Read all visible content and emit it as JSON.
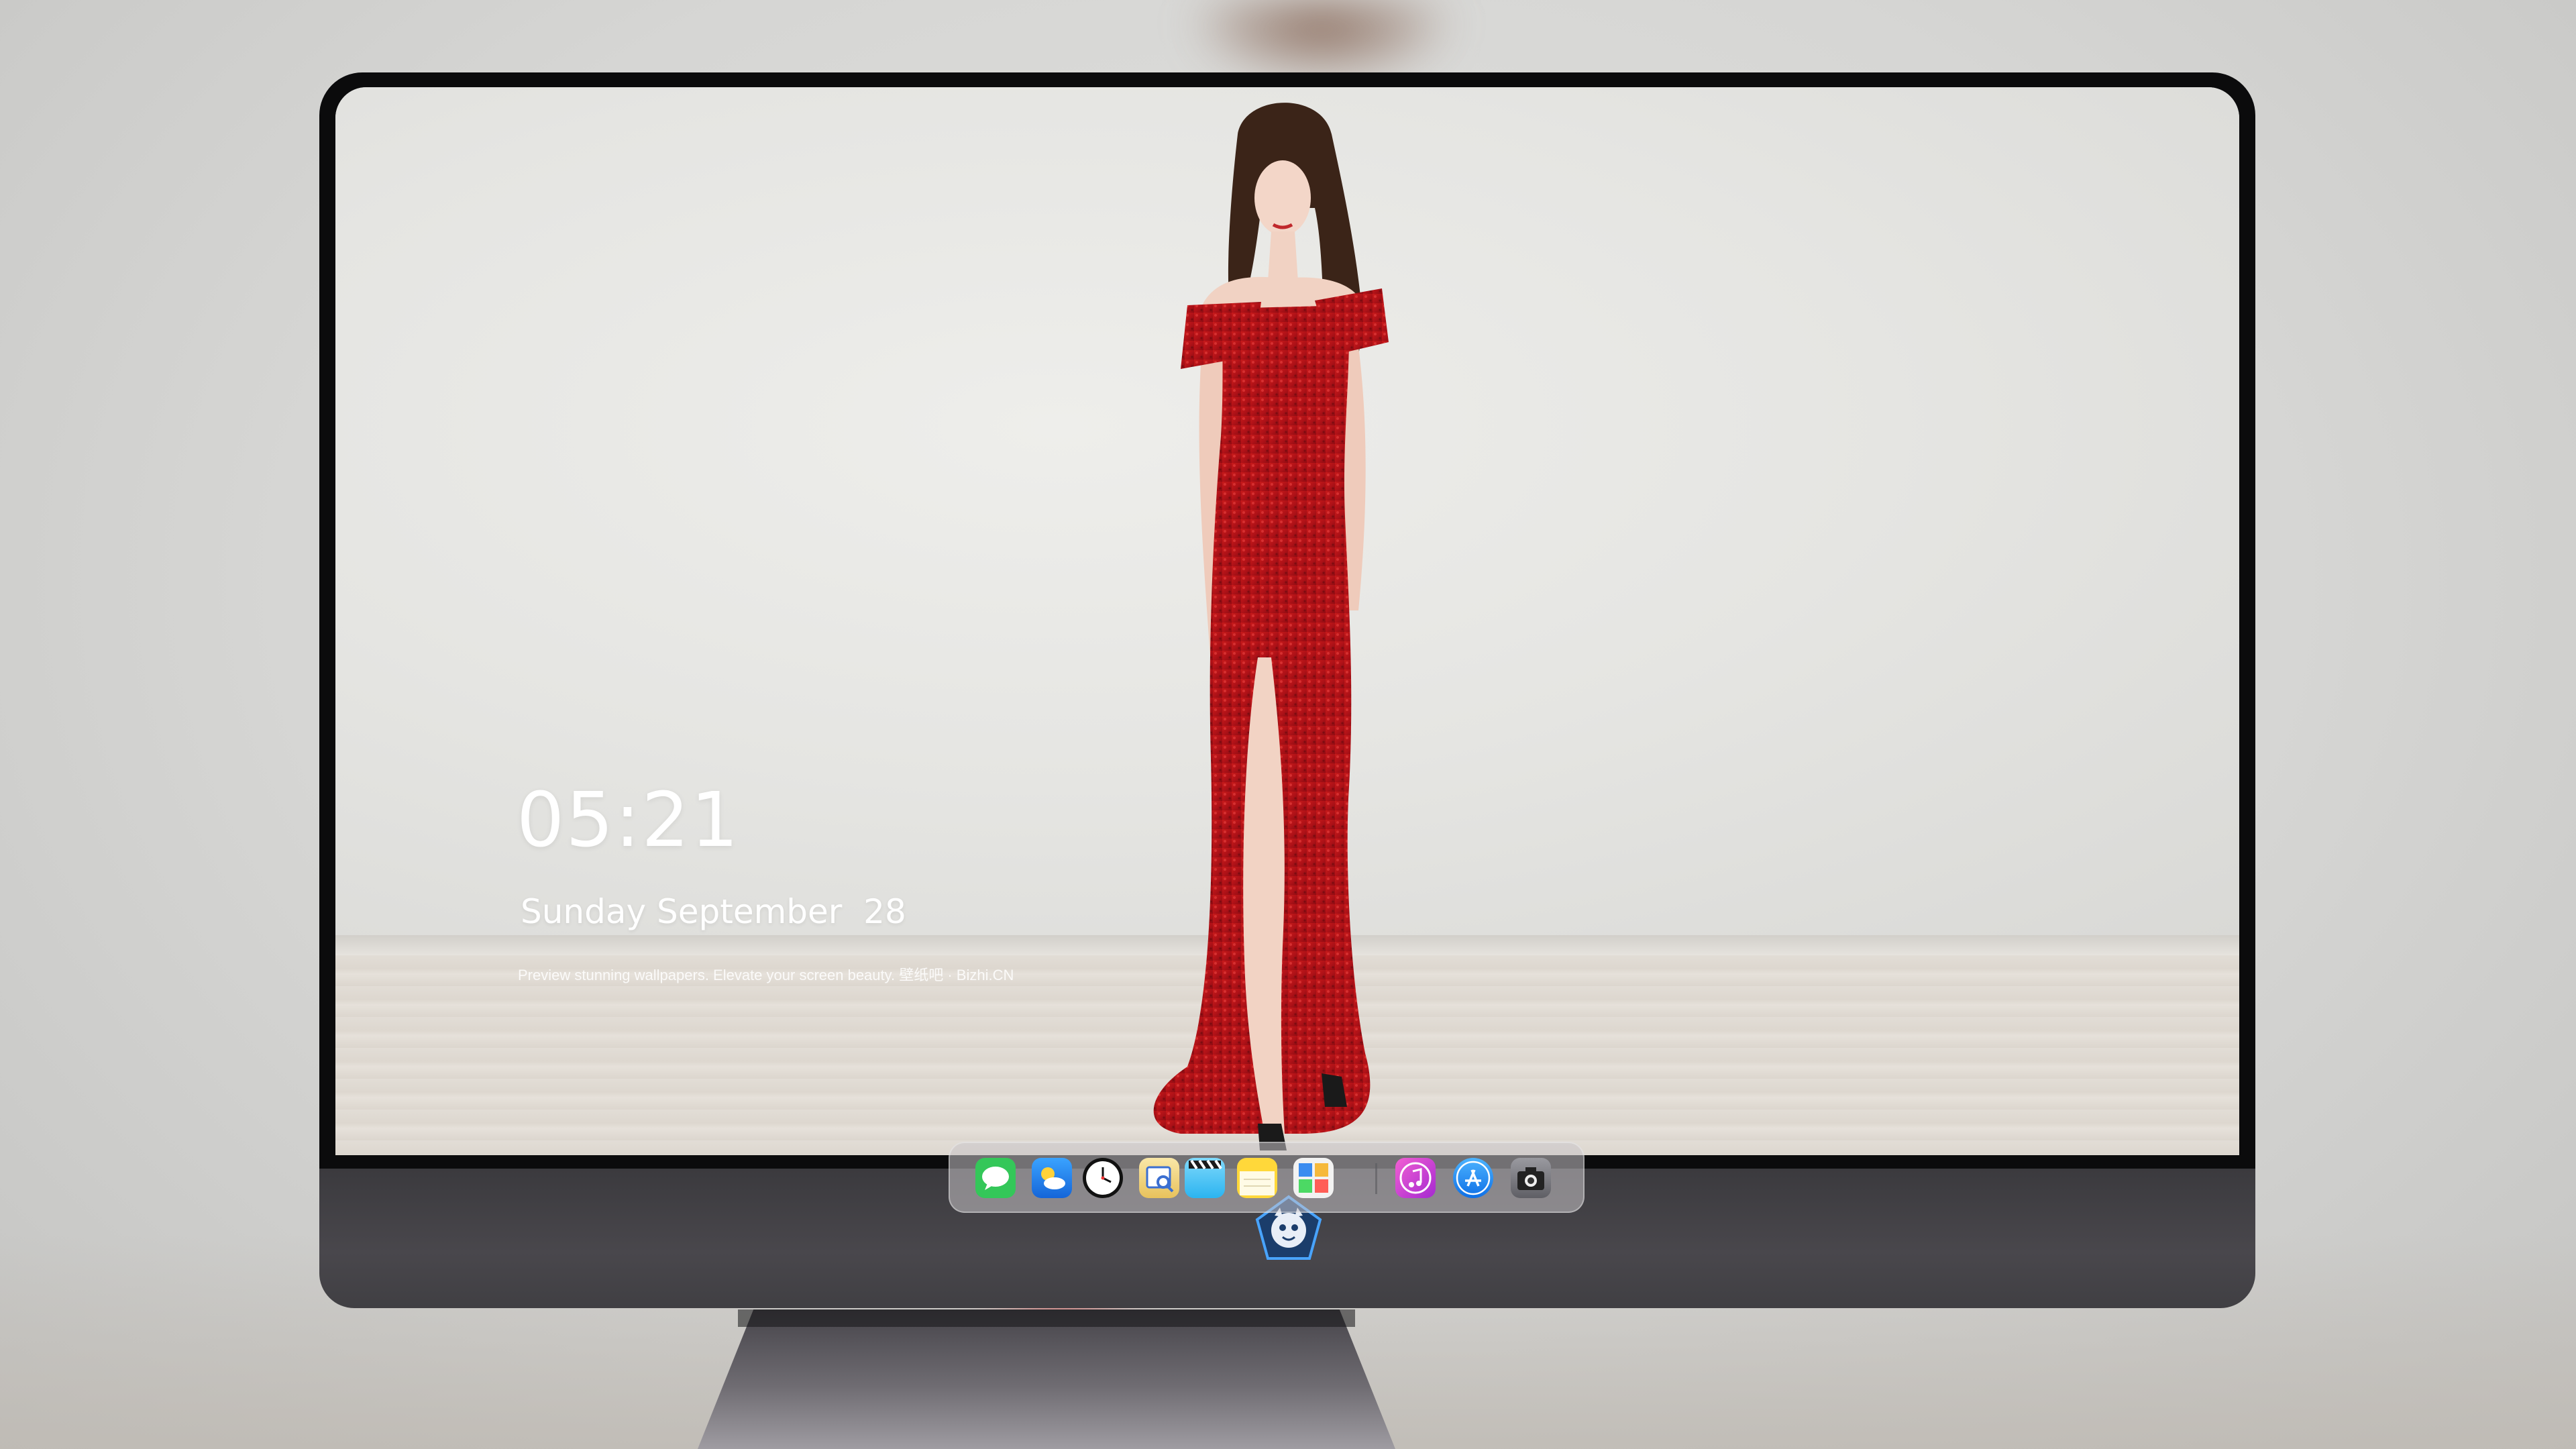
{
  "lock_screen": {
    "time": "05:21",
    "date": "Sunday September  28",
    "tagline": "Preview stunning wallpapers. Elevate your screen beauty.   壁纸吧 · Bizhi.CN"
  },
  "dock": {
    "items": [
      {
        "name": "messages-icon",
        "color": "#34c759"
      },
      {
        "name": "weather-icon",
        "color": "#2f8ff0"
      },
      {
        "name": "clock-icon",
        "color": "#ffffff"
      },
      {
        "name": "preview-icon",
        "color": "#f2d27a"
      },
      {
        "name": "clips-icon",
        "color": "#5ac8fa"
      },
      {
        "name": "notes-icon",
        "color": "#ffd83a"
      },
      {
        "name": "photo-browser-icon",
        "color": "#f0f0f0"
      },
      {
        "name": "music-icon",
        "color": "#d03ad8"
      },
      {
        "name": "app-store-icon",
        "color": "#1a8cff"
      },
      {
        "name": "camera-icon",
        "color": "#8e8e93"
      }
    ]
  },
  "chin_logo": "mascot-logo-icon"
}
